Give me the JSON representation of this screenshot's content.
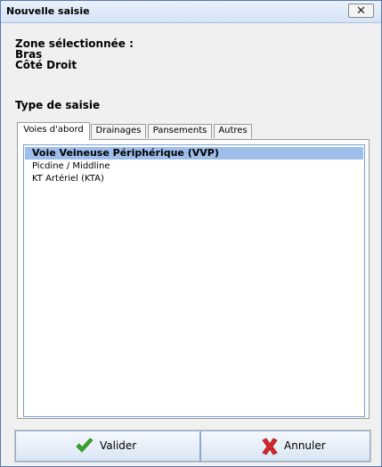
{
  "window": {
    "title": "Nouvelle saisie",
    "close_glyph": "✕"
  },
  "info": {
    "zone_label": "Zone sélectionnée :",
    "zone_value": "Bras",
    "side_value": "Côté Droit"
  },
  "type_label": "Type de saisie",
  "tabs": [
    {
      "label": "Voies d'abord",
      "active": true
    },
    {
      "label": "Drainages",
      "active": false
    },
    {
      "label": "Pansements",
      "active": false
    },
    {
      "label": "Autres",
      "active": false
    }
  ],
  "list": {
    "items": [
      {
        "label": "Voie Veineuse Périphérique (VVP)",
        "selected": true
      },
      {
        "label": "Picdine / Middline",
        "selected": false
      },
      {
        "label": "KT Artériel (KTA)",
        "selected": false
      }
    ]
  },
  "buttons": {
    "validate_label": "Valider",
    "cancel_label": "Annuler",
    "validate_icon": "check-icon",
    "cancel_icon": "cross-icon"
  },
  "colors": {
    "selection": "#9dbdeb",
    "check_green": "#3aa52c",
    "cross_red": "#d8262a",
    "window_border": "#5a7ab5"
  }
}
